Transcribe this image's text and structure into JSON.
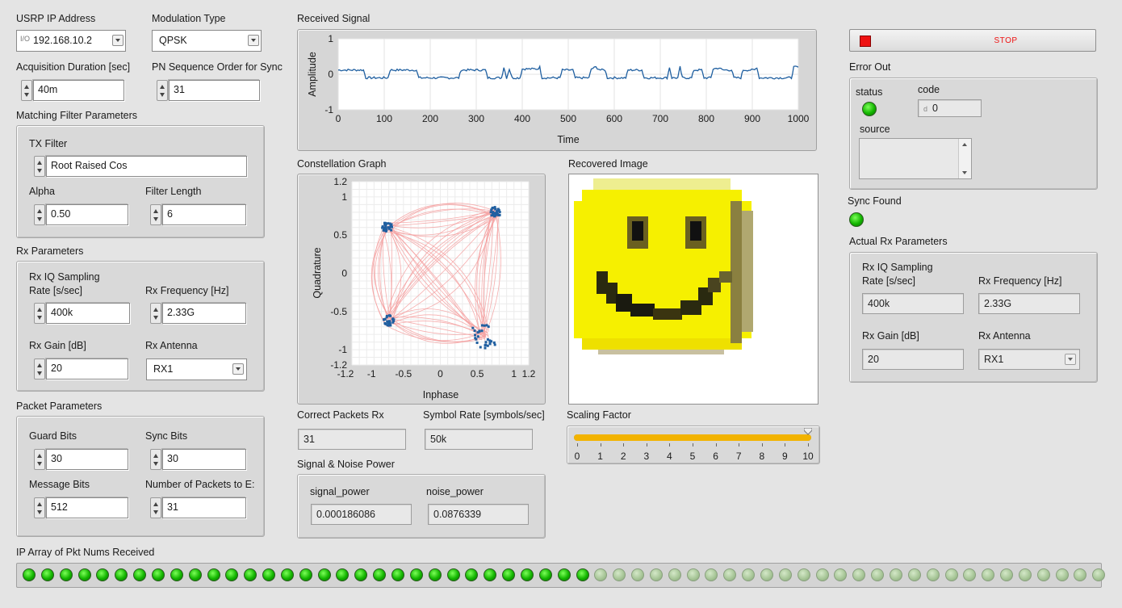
{
  "usrp": {
    "label": "USRP IP Address",
    "value": "192.168.10.2"
  },
  "modulation": {
    "label": "Modulation Type",
    "value": "QPSK"
  },
  "acq": {
    "label": "Acquisition Duration [sec]",
    "value": "40m"
  },
  "pn": {
    "label": "PN Sequence Order for Sync",
    "value": "31"
  },
  "matching": {
    "title": "Matching Filter Parameters",
    "tx_label": "TX Filter",
    "tx_value": "Root Raised Cos",
    "alpha_label": "Alpha",
    "alpha_value": "0.50",
    "len_label": "Filter Length",
    "len_value": "6"
  },
  "rx": {
    "title": "Rx Parameters",
    "rate_label1": "Rx IQ Sampling",
    "rate_label2": "Rate [s/sec]",
    "rate_value": "400k",
    "freq_label": "Rx Frequency [Hz]",
    "freq_value": "2.33G",
    "gain_label": "Rx Gain [dB]",
    "gain_value": "20",
    "ant_label": "Rx Antenna",
    "ant_value": "RX1"
  },
  "packet": {
    "title": "Packet Parameters",
    "guard_label": "Guard Bits",
    "guard_value": "30",
    "sync_label": "Sync Bits",
    "sync_value": "30",
    "msg_label": "Message Bits",
    "msg_value": "512",
    "num_label": "Number of Packets to E:",
    "num_value": "31"
  },
  "received_signal": {
    "title": "Received Signal",
    "chart_data": {
      "type": "line",
      "xlabel": "Time",
      "ylabel": "Amplitude",
      "xlim": [
        0,
        1000
      ],
      "ylim": [
        -1,
        1
      ],
      "xticks": [
        "0",
        "100",
        "200",
        "300",
        "400",
        "500",
        "600",
        "700",
        "800",
        "900",
        "1000"
      ],
      "yticks": [
        "1",
        "0",
        "-1"
      ],
      "segments": [
        [
          0,
          0.12
        ],
        [
          55,
          0.12
        ],
        [
          60,
          -0.1
        ],
        [
          108,
          -0.1
        ],
        [
          113,
          0.12
        ],
        [
          170,
          0.12
        ],
        [
          175,
          -0.1
        ],
        [
          262,
          -0.1
        ],
        [
          267,
          0.12
        ],
        [
          320,
          0.12
        ],
        [
          325,
          -0.1
        ],
        [
          355,
          -0.1
        ],
        [
          360,
          0.2
        ],
        [
          366,
          -0.1
        ],
        [
          372,
          0.15
        ],
        [
          378,
          -0.1
        ],
        [
          395,
          -0.1
        ],
        [
          400,
          0.15
        ],
        [
          433,
          0.15
        ],
        [
          438,
          0.2
        ],
        [
          443,
          -0.1
        ],
        [
          482,
          -0.1
        ],
        [
          487,
          0.12
        ],
        [
          510,
          0.12
        ],
        [
          515,
          -0.1
        ],
        [
          545,
          -0.1
        ],
        [
          550,
          0.15
        ],
        [
          560,
          0.2
        ],
        [
          570,
          0.12
        ],
        [
          580,
          0.12
        ],
        [
          585,
          -0.1
        ],
        [
          625,
          -0.1
        ],
        [
          630,
          0.12
        ],
        [
          660,
          0.12
        ],
        [
          665,
          -0.1
        ],
        [
          715,
          -0.1
        ],
        [
          720,
          0.2
        ],
        [
          725,
          -0.1
        ],
        [
          738,
          -0.1
        ],
        [
          743,
          0.2
        ],
        [
          748,
          -0.1
        ],
        [
          768,
          -0.1
        ],
        [
          773,
          0.12
        ],
        [
          790,
          0.12
        ],
        [
          795,
          -0.1
        ],
        [
          810,
          -0.1
        ],
        [
          815,
          0.15
        ],
        [
          828,
          0.18
        ],
        [
          835,
          0.12
        ],
        [
          855,
          0.12
        ],
        [
          860,
          -0.1
        ],
        [
          875,
          -0.1
        ],
        [
          880,
          0.12
        ],
        [
          905,
          0.12
        ],
        [
          910,
          0.2
        ],
        [
          915,
          -0.1
        ],
        [
          985,
          -0.1
        ],
        [
          990,
          0.2
        ],
        [
          1000,
          0.2
        ]
      ]
    }
  },
  "constellation": {
    "title": "Constellation Graph",
    "chart_data": {
      "type": "scatter",
      "xlabel": "Inphase",
      "ylabel": "Quadrature",
      "xlim": [
        -1.2,
        1.2
      ],
      "ylim": [
        -1.2,
        1.2
      ],
      "xticks": [
        "-1.2",
        "-1",
        "-0.5",
        "0",
        "0.5",
        "1",
        "1.2"
      ],
      "yticks": [
        "1.2",
        "1",
        "0.5",
        "0",
        "-0.5",
        "-1",
        "-1.2"
      ],
      "clusters": [
        [
          0.75,
          0.8
        ],
        [
          -0.7,
          -0.62
        ],
        [
          -0.72,
          0.6
        ],
        [
          0.6,
          -0.82
        ]
      ]
    }
  },
  "recovered_image": {
    "title": "Recovered Image"
  },
  "stop": {
    "label": "STOP"
  },
  "error_out": {
    "title": "Error Out",
    "status_label": "status",
    "code_label": "code",
    "code_value": "0",
    "source_label": "source",
    "d_prefix": "d"
  },
  "sync_found": {
    "label": "Sync Found"
  },
  "actual_rx": {
    "title": "Actual Rx Parameters",
    "rate_label1": "Rx IQ Sampling",
    "rate_label2": "Rate [s/sec]",
    "rate_value": "400k",
    "freq_label": "Rx Frequency [Hz]",
    "freq_value": "2.33G",
    "gain_label": "Rx Gain [dB]",
    "gain_value": "20",
    "ant_label": "Rx Antenna",
    "ant_value": "RX1"
  },
  "correct_packets": {
    "label": "Correct Packets Rx",
    "value": "31"
  },
  "symbol_rate": {
    "label": "Symbol Rate [symbols/sec]",
    "value": "50k"
  },
  "scaling": {
    "label": "Scaling Factor",
    "ticks": [
      "0",
      "1",
      "2",
      "3",
      "4",
      "5",
      "6",
      "7",
      "8",
      "9",
      "10"
    ],
    "value": 10,
    "max": 10
  },
  "snp": {
    "title": "Signal & Noise Power",
    "signal_label": "signal_power",
    "signal_value": "0.000186086",
    "noise_label": "noise_power",
    "noise_value": "0.0876339"
  },
  "pkt_array": {
    "label": "IP Array of Pkt Nums Received",
    "on_count": 31,
    "total": 59
  },
  "colors": {
    "trace": "#1f5fa0",
    "scatter_trace": "#f4a0a0",
    "scatter_point": "#1f5fa0",
    "led_on": "#22c400",
    "stop_red": "#ee1111",
    "slider_fill": "#f2b300"
  }
}
